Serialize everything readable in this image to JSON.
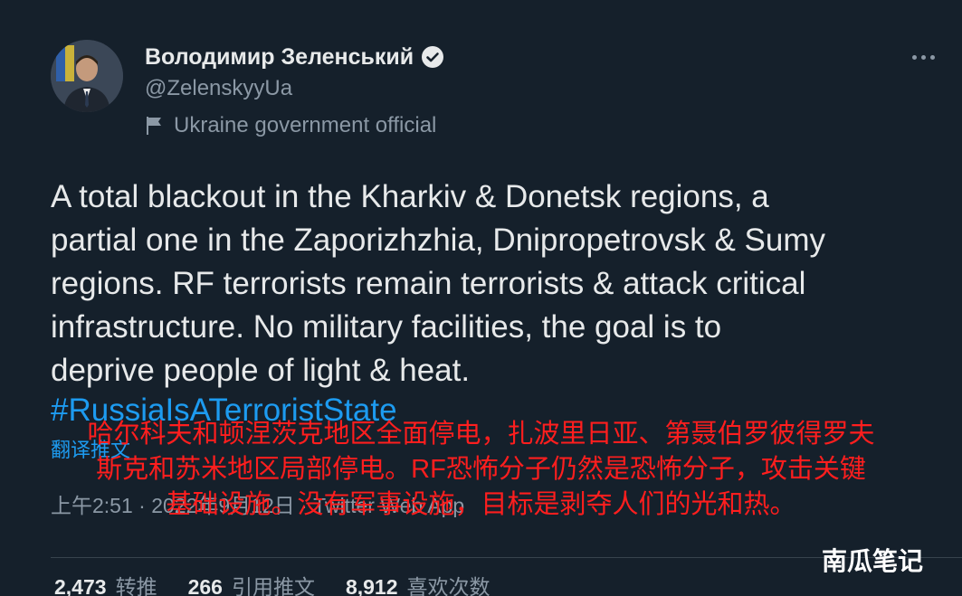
{
  "author": {
    "display_name": "Володимир Зеленський",
    "handle": "@ZelenskyyUa",
    "label": "Ukraine government official",
    "verified_icon": "verified-badge-icon",
    "label_icon": "flag-icon"
  },
  "more_icon": "more-icon",
  "tweet": {
    "lines": [
      "A total blackout in the Kharkiv & Donetsk regions, a",
      "partial one in the Zaporizhzhia, Dnipropetrovsk & Sumy",
      "regions. RF terrorists remain terrorists & attack critical",
      "infrastructure. No military facilities, the goal is to",
      "deprive people of light & heat."
    ],
    "hashtag": "#RussiaIsATerroristState",
    "translate_label": "翻译推文",
    "timestamp": "上午2:51 · 2022年9月12日 · Twitter Web App"
  },
  "stats": [
    {
      "count": "2,473",
      "label": "转推"
    },
    {
      "count": "266",
      "label": "引用推文"
    },
    {
      "count": "8,912",
      "label": "喜欢次数"
    }
  ],
  "caption": {
    "lines": [
      "哈尔科夫和顿涅茨克地区全面停电，扎波里日亚、第聂伯罗彼得罗夫",
      "斯克和苏米地区局部停电。RF恐怖分子仍然是恐怖分子，攻击关键",
      "基础设施。没有军事设施，目标是剥夺人们的光和热。"
    ],
    "color": "#ff1e1e"
  },
  "watermark": "南瓜笔记",
  "colors": {
    "background": "#15202b",
    "text": "#e7e9ea",
    "secondary": "#8b98a5",
    "link": "#1d9bf0"
  }
}
